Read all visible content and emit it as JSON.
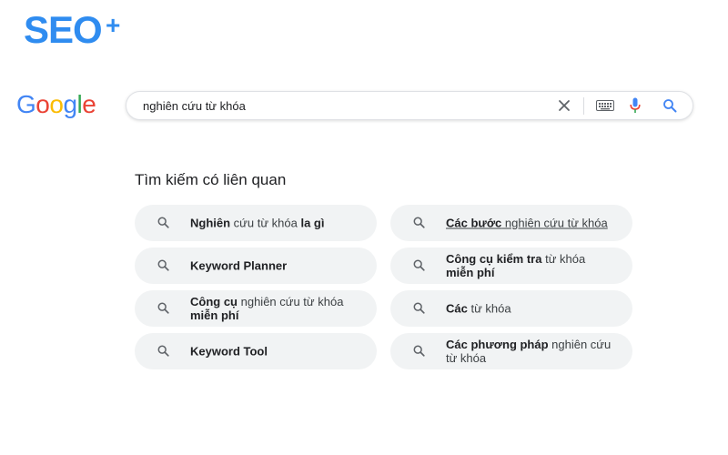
{
  "brand": {
    "text": "SEO",
    "plus": "+",
    "color": "#2f8cf0"
  },
  "google_logo": {
    "letters": [
      "G",
      "o",
      "o",
      "g",
      "l",
      "e"
    ],
    "colors": [
      "#4285F4",
      "#EA4335",
      "#FBBC05",
      "#4285F4",
      "#34A853",
      "#EA4335"
    ]
  },
  "search": {
    "query": "nghiên cứu từ khóa",
    "icons": [
      "clear-icon",
      "keyboard-icon",
      "microphone-icon",
      "search-icon"
    ]
  },
  "related": {
    "title": "Tìm kiếm có liên quan",
    "items": [
      {
        "line1": [
          {
            "t": "Nghiên",
            "b": true
          },
          {
            "t": " cứu từ khóa ",
            "b": false
          },
          {
            "t": "la gì",
            "b": true
          }
        ],
        "line2": []
      },
      {
        "line1": [
          {
            "t": "Các bước",
            "b": true
          },
          {
            "t": " nghiên cứu từ khóa",
            "b": false
          }
        ],
        "line2": [],
        "underline": true
      },
      {
        "line1": [
          {
            "t": "Keyword Planner",
            "b": true
          }
        ],
        "line2": []
      },
      {
        "line1": [
          {
            "t": "Công cụ kiểm tra",
            "b": true
          },
          {
            "t": " từ khóa",
            "b": false
          }
        ],
        "line2": [
          {
            "t": "miễn phí",
            "b": true
          }
        ]
      },
      {
        "line1": [
          {
            "t": "Công cụ",
            "b": true
          },
          {
            "t": " nghiên cứu từ khóa",
            "b": false
          }
        ],
        "line2": [
          {
            "t": "miễn phí",
            "b": true
          }
        ]
      },
      {
        "line1": [
          {
            "t": "Các",
            "b": true
          },
          {
            "t": " từ khóa",
            "b": false
          }
        ],
        "line2": []
      },
      {
        "line1": [
          {
            "t": "Keyword Tool",
            "b": true
          }
        ],
        "line2": []
      },
      {
        "line1": [
          {
            "t": "Các phương pháp",
            "b": true
          },
          {
            "t": " nghiên cứu",
            "b": false
          }
        ],
        "line2": [
          {
            "t": "từ khóa",
            "b": false
          }
        ]
      }
    ]
  },
  "colors": {
    "chip_bg": "#f1f3f4",
    "mic_blue": "#4285F4",
    "mic_red": "#EA4335"
  }
}
